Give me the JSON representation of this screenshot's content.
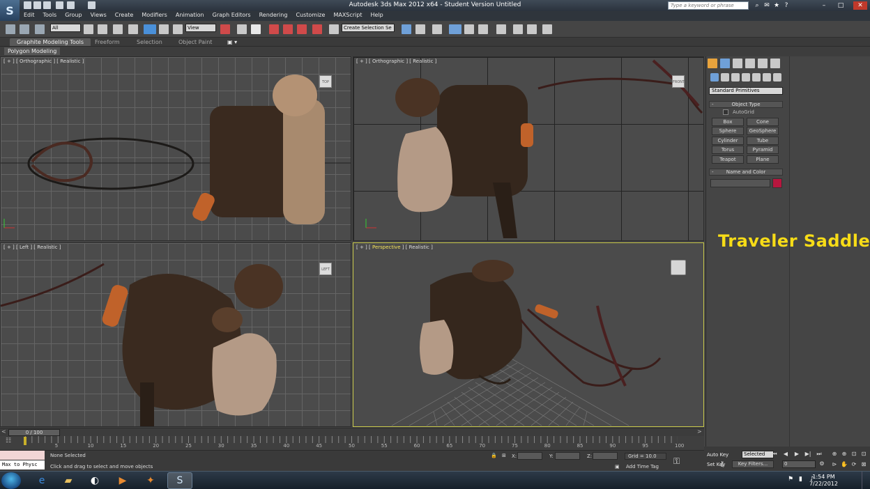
{
  "titlebar": {
    "title": "Autodesk 3ds Max  2012 x64  - Student Version   Untitled",
    "search_placeholder": "Type a keyword or phrase",
    "logo": "3ds-max-logo"
  },
  "menu": [
    "Edit",
    "Tools",
    "Group",
    "Views",
    "Create",
    "Modifiers",
    "Animation",
    "Graph Editors",
    "Rendering",
    "Customize",
    "MAXScript",
    "Help"
  ],
  "toolbar": {
    "filter_value": "All",
    "refcoord_value": "View",
    "selection_set_placeholder": "Create Selection Se"
  },
  "ribbon": {
    "tabs": [
      "Graphite Modeling Tools",
      "Freeform",
      "Selection",
      "Object Paint"
    ],
    "active_tab": "Graphite Modeling Tools",
    "sub_panel": "Polygon Modeling"
  },
  "viewports": {
    "top_left": {
      "label": "[ + ] [ Orthographic ] [ Realistic ]",
      "cube": "TOP"
    },
    "top_right": {
      "label": "[ + ] [ Orthographic ] [ Realistic ]",
      "cube": "FRONT"
    },
    "bottom_left": {
      "label": "[ + ] [ Left ] [ Realistic ]",
      "cube": "LEFT"
    },
    "bottom_right": {
      "label_pre": "[ + ] [ ",
      "label_active": "Perspective",
      "label_post": " ] [ Realistic ]"
    }
  },
  "command_panel": {
    "primitive_type": "Standard Primitives",
    "object_type_title": "Object Type",
    "autogrid": "AutoGrid",
    "buttons": [
      "Box",
      "Cone",
      "Sphere",
      "GeoSphere",
      "Cylinder",
      "Tube",
      "Torus",
      "Pyramid",
      "Teapot",
      "Plane"
    ],
    "name_color_title": "Name and Color",
    "object_color": "#b7163e"
  },
  "overlay_title": "Traveler Saddle",
  "timeline": {
    "frame_display": "0 / 100",
    "current_frame": 0,
    "total_frames": 100,
    "tick_labels": [
      "5",
      "10",
      "15",
      "20",
      "25",
      "30",
      "35",
      "40",
      "45",
      "50",
      "55",
      "60",
      "65",
      "70",
      "75",
      "80",
      "85",
      "90",
      "95",
      "100"
    ]
  },
  "status": {
    "maxscript_line1": "",
    "maxscript_line2": "Max to Physc",
    "selection": "None Selected",
    "prompt": "Click and drag to select and move objects",
    "x_label": "X:",
    "y_label": "Y:",
    "z_label": "Z:",
    "grid": "Grid = 10.0",
    "add_time_tag": "Add Time Tag",
    "auto_key": "Auto Key",
    "set_key": "Set Key",
    "key_mode": "Selected",
    "key_filters": "Key Filters...",
    "frame_input": "0"
  },
  "taskbar": {
    "time": "1:54 PM",
    "date": "7/22/2012"
  }
}
